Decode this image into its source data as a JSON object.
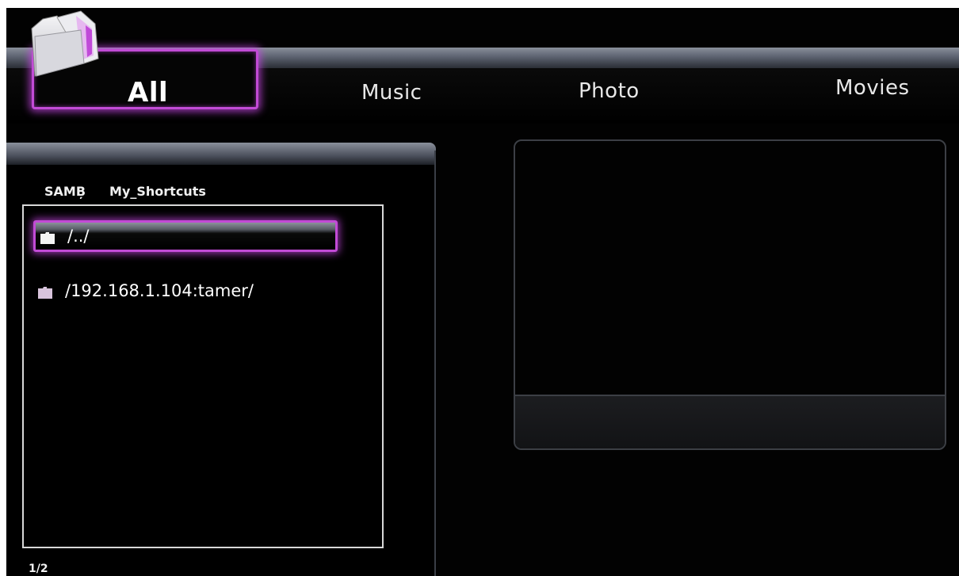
{
  "tabs": [
    {
      "label": "All",
      "selected": true
    },
    {
      "label": "Music",
      "selected": false
    },
    {
      "label": "Photo",
      "selected": false
    },
    {
      "label": "Movies",
      "selected": false
    }
  ],
  "breadcrumb": {
    "root": "SAMB̦",
    "current": "My_Shortcuts"
  },
  "file_list": {
    "items": [
      {
        "label": "/../",
        "icon": "folder-icon",
        "selected": true
      },
      {
        "label": "/192.168.1.104:tamer/",
        "icon": "folder-icon",
        "selected": false
      }
    ]
  },
  "pager": {
    "text": "1/2"
  },
  "colors": {
    "highlight": "#c24bd6",
    "background": "#020202",
    "bar": "#5c6270",
    "text": "#ffffff"
  },
  "header_icon": "folder-icon"
}
